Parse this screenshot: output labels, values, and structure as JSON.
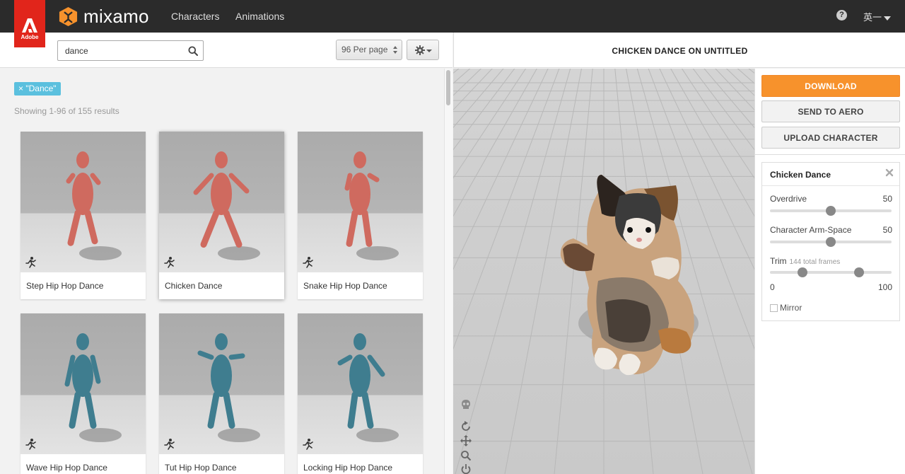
{
  "nav": {
    "adobe_label": "Adobe",
    "brand": "mixamo",
    "links": [
      "Characters",
      "Animations"
    ],
    "help_label": "?",
    "user_label": "英一"
  },
  "toolbar": {
    "search_value": "dance",
    "per_page": "96 Per page"
  },
  "results": {
    "filter_tag": "× \"Dance\"",
    "count_text": "Showing 1-96 of 155 results",
    "cards": [
      {
        "label": "Step Hip Hop Dance",
        "color": "#cf6a5f"
      },
      {
        "label": "Chicken Dance",
        "color": "#cf6a5f"
      },
      {
        "label": "Snake Hip Hop Dance",
        "color": "#cf6a5f"
      },
      {
        "label": "Wave Hip Hop Dance",
        "color": "#3f7d8f"
      },
      {
        "label": "Tut Hip Hop Dance",
        "color": "#3f7d8f"
      },
      {
        "label": "Locking Hip Hop Dance",
        "color": "#3f7d8f"
      }
    ]
  },
  "preview": {
    "title": "CHICKEN DANCE ON UNTITLED"
  },
  "actions": {
    "download": "DOWNLOAD",
    "send_to_aero": "SEND TO AERO",
    "upload_character": "UPLOAD CHARACTER"
  },
  "settings": {
    "title": "Chicken Dance",
    "overdrive": {
      "label": "Overdrive",
      "value": "50",
      "level": 0.5
    },
    "arm_space": {
      "label": "Character Arm-Space",
      "value": "50",
      "level": 0.5
    },
    "trim": {
      "label": "Trim",
      "sub": "144 total frames",
      "start": "0",
      "end": "100",
      "start_level": 0.27,
      "end_level": 0.73
    },
    "mirror": {
      "label": "Mirror",
      "checked": false
    }
  },
  "colors": {
    "accent": "#f7922c",
    "topbar": "#2b2b2b",
    "adobe_red": "#e1251b",
    "tag": "#5bc0de"
  }
}
